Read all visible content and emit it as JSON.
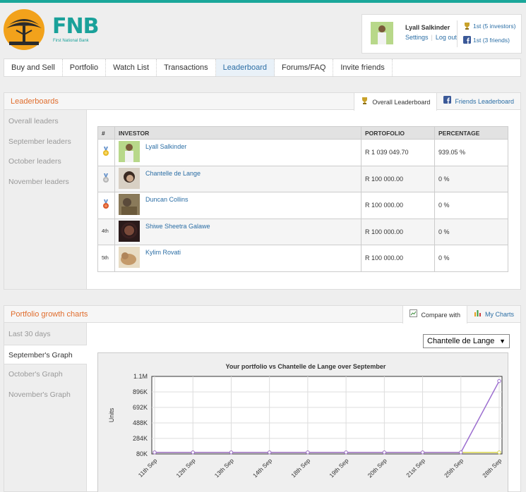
{
  "brand": {
    "name": "FNB",
    "subtitle": "First National Bank"
  },
  "user": {
    "name": "Lyall Salkinder",
    "settings": "Settings",
    "logout": "Log out",
    "rank_investors": "1st (5 investors)",
    "rank_friends": "1st (3 friends)"
  },
  "nav": [
    "Buy and Sell",
    "Portfolio",
    "Watch List",
    "Transactions",
    "Leaderboard",
    "Forums/FAQ",
    "Invite friends"
  ],
  "leaderboards": {
    "title": "Leaderboards",
    "tab_overall": "Overall Leaderboard",
    "tab_friends": "Friends Leaderboard",
    "side": [
      "Overall leaders",
      "September leaders",
      "October leaders",
      "November leaders"
    ],
    "headers": {
      "rank": "#",
      "investor": "INVESTOR",
      "portfolio": "PORTOFOLIO",
      "percentage": "PERCENTAGE"
    },
    "rows": [
      {
        "rank": "",
        "medal": "gold",
        "name": "Lyall Salkinder",
        "portfolio": "R 1 039 049.70",
        "percentage": "939.05 %"
      },
      {
        "rank": "",
        "medal": "silver",
        "name": "Chantelle de Lange",
        "portfolio": "R 100 000.00",
        "percentage": "0 %"
      },
      {
        "rank": "",
        "medal": "bronze",
        "name": "Duncan Collins",
        "portfolio": "R 100 000.00",
        "percentage": "0 %"
      },
      {
        "rank": "4th",
        "medal": "",
        "name": "Shiwe Sheetra Galawe",
        "portfolio": "R 100 000.00",
        "percentage": "0 %"
      },
      {
        "rank": "5th",
        "medal": "",
        "name": "Kylim Rovati",
        "portfolio": "R 100 000.00",
        "percentage": "0 %"
      }
    ]
  },
  "growth": {
    "title": "Portfolio growth charts",
    "tab_compare": "Compare with",
    "tab_mycharts": "My Charts",
    "side": [
      "Last 30 days",
      "September's Graph",
      "October's Graph",
      "November's Graph"
    ],
    "compare_selected": "Chantelle de Lange"
  },
  "colors": {
    "accent": "#e06d2d",
    "link": "#2b6ea5",
    "brand": "#1aa19a",
    "line_user": "#9b6dcf",
    "line_other": "#d7d24a"
  },
  "chart_data": {
    "type": "line",
    "title": "Your portfolio vs Chantelle de Lange  over September",
    "xlabel": "",
    "ylabel": "Units",
    "categories": [
      "11th Sep",
      "12th Sep",
      "13th Sep",
      "14th Sep",
      "18th Sep",
      "19th Sep",
      "20th Sep",
      "21st Sep",
      "25th Sep",
      "28th Sep"
    ],
    "yticks": [
      "80K",
      "284K",
      "488K",
      "692K",
      "896K",
      "1.1M"
    ],
    "ylim": [
      80000,
      1100000
    ],
    "series": [
      {
        "values": [
          100000,
          100000,
          100000,
          100000,
          100000,
          100000,
          100000,
          100000,
          100000,
          1039049.7
        ]
      },
      {
        "values": [
          100000,
          100000,
          100000,
          100000,
          100000,
          100000,
          100000,
          100000,
          100000,
          100000
        ]
      }
    ],
    "grid": true
  }
}
